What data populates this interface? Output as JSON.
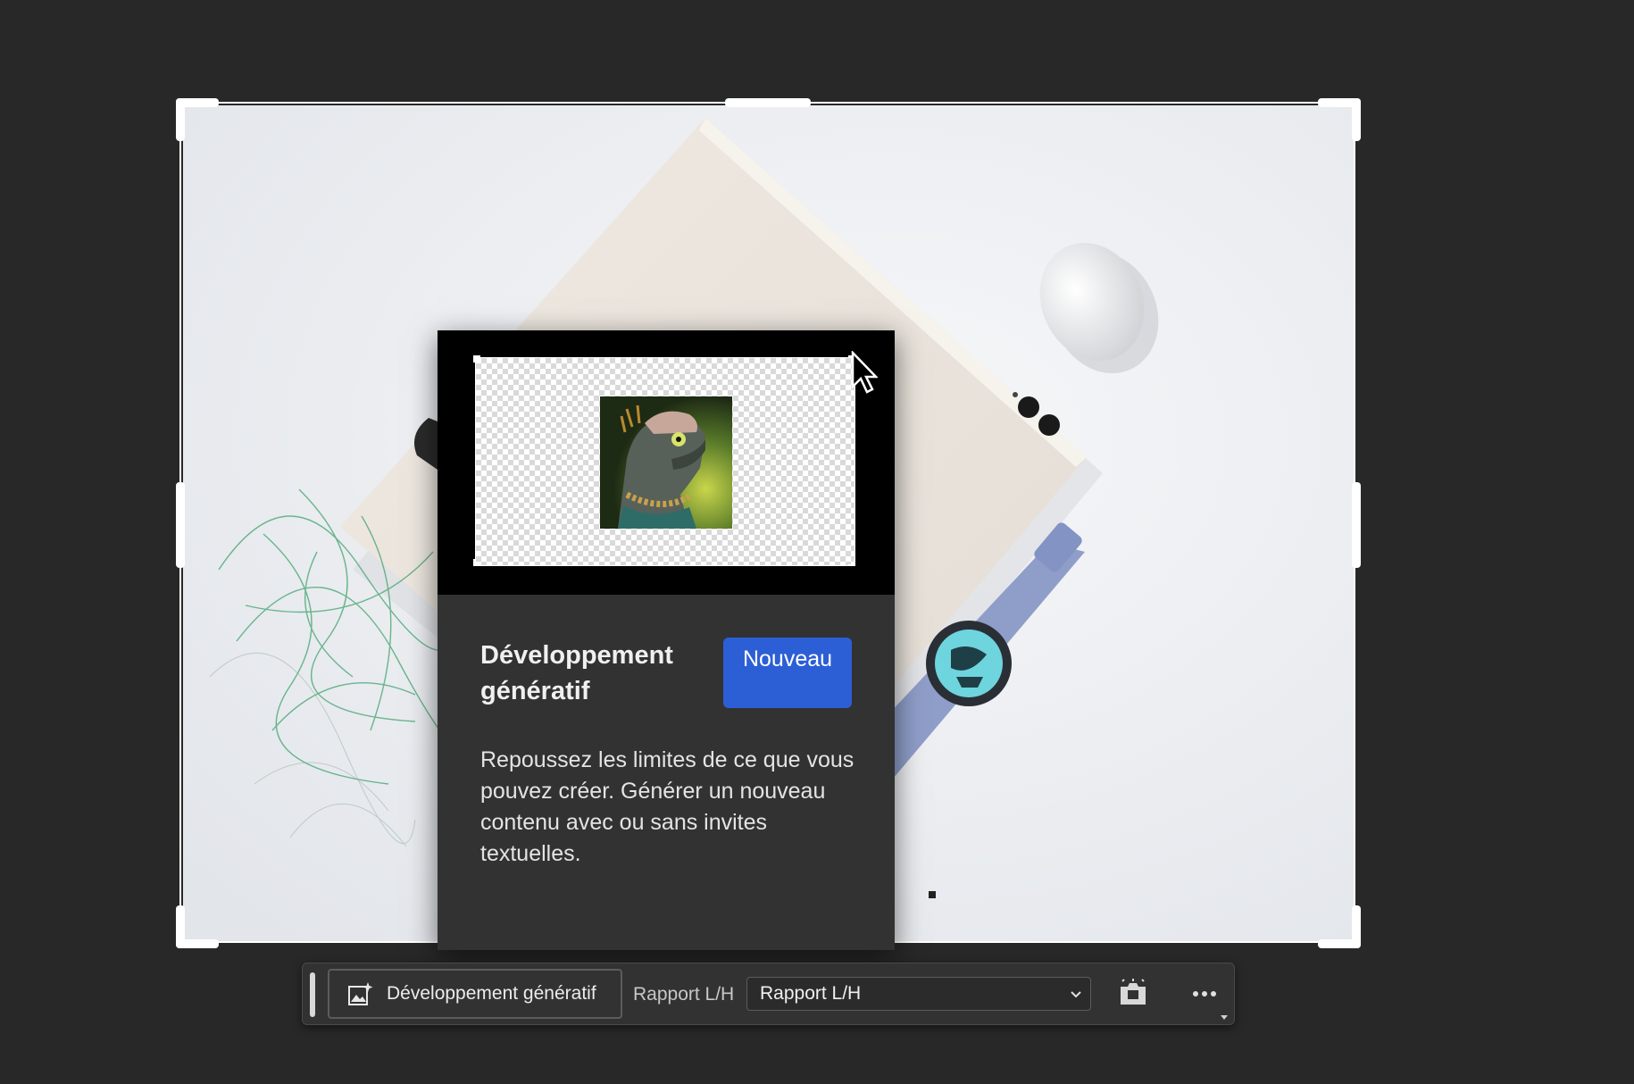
{
  "popover": {
    "title": "Développement génératif",
    "badge": "Nouveau",
    "description": "Repoussez les limites de ce que vous pouvez créer. Générer un nouveau contenu avec ou sans invites textuelles."
  },
  "taskbar": {
    "generative_expand_label": "Développement génératif",
    "ratio_label": "Rapport L/H",
    "ratio_value": "Rapport L/H"
  },
  "icons": {
    "generative": "generative-expand-icon",
    "ratio_dropdown": "chevron-down-icon",
    "fill": "fill-icon",
    "more": "more-icon"
  },
  "colors": {
    "background": "#282828",
    "panel": "#323232",
    "accent": "#2c5fd6",
    "text": "#f0f0f0"
  }
}
